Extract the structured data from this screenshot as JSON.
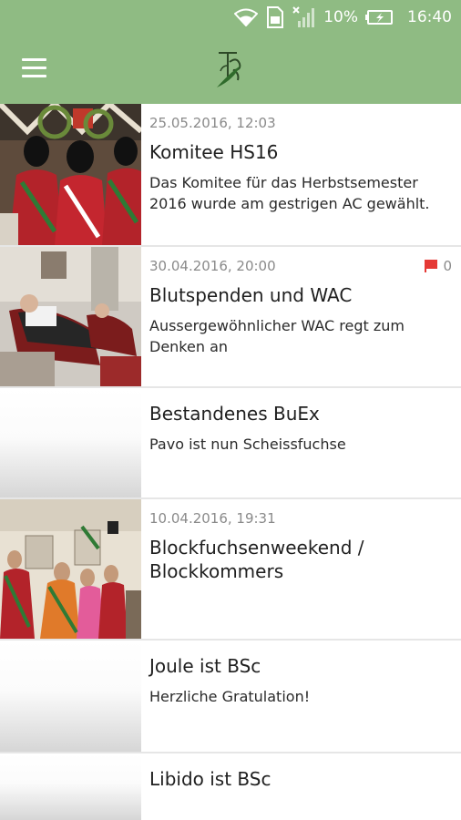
{
  "status_bar": {
    "battery": "10%",
    "time": "16:40",
    "icons": [
      "wifi-icon",
      "sim-icon",
      "signal-icon",
      "battery-icon"
    ]
  },
  "app_bar": {
    "menu_icon": "hamburger-menu-icon",
    "logo": "club-monogram-logo"
  },
  "colors": {
    "app_bar": "#8fbb83",
    "comment_flag": "#e53935",
    "divider": "#e6e6e6"
  },
  "feed": [
    {
      "date": "25.05.2016, 12:03",
      "title": "Komitee HS16",
      "description": "Das Komitee für das Herbstsemester 2016 wurde am gestrigen AC gewählt."
    },
    {
      "date": "30.04.2016, 20:00",
      "title": "Blutspenden und WAC",
      "description": "Aussergewöhnlicher WAC regt zum Denken an",
      "comments": "0"
    },
    {
      "title": "Bestandenes BuEx",
      "description": "Pavo ist nun Scheissfuchse"
    },
    {
      "date": "10.04.2016, 19:31",
      "title": "Blockfuchsenweekend / Blockkommers"
    },
    {
      "title": "Joule ist BSc",
      "description": "Herzliche Gratulation!"
    },
    {
      "title": "Libido ist BSc"
    }
  ]
}
